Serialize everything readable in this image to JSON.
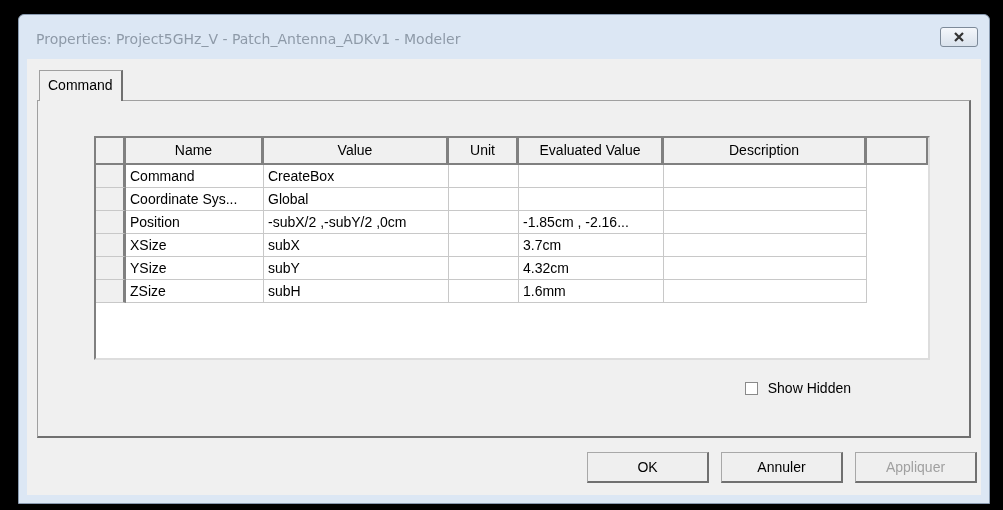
{
  "window": {
    "title": "Properties: Project5GHz_V - Patch_Antenna_ADKv1 - Modeler"
  },
  "tabs": [
    {
      "label": "Command",
      "selected": true
    }
  ],
  "table": {
    "columns": [
      "Name",
      "Value",
      "Unit",
      "Evaluated Value",
      "Description"
    ],
    "rows": [
      {
        "cells": [
          "Command",
          "CreateBox",
          "",
          "",
          ""
        ]
      },
      {
        "cells": [
          "Coordinate Sys...",
          "Global",
          "",
          "",
          ""
        ]
      },
      {
        "cells": [
          "Position",
          "-subX/2 ,-subY/2 ,0cm",
          "",
          "-1.85cm , -2.16...",
          ""
        ]
      },
      {
        "cells": [
          "XSize",
          "subX",
          "",
          "3.7cm",
          ""
        ]
      },
      {
        "cells": [
          "YSize",
          "subY",
          "",
          "4.32cm",
          ""
        ]
      },
      {
        "cells": [
          "ZSize",
          "subH",
          "",
          "1.6mm",
          ""
        ]
      }
    ]
  },
  "show_hidden": {
    "label": "Show Hidden",
    "checked": false
  },
  "buttons": [
    {
      "label": "OK",
      "disabled": false
    },
    {
      "label": "Annuler",
      "disabled": false
    },
    {
      "label": "Appliquer",
      "disabled": true
    }
  ]
}
